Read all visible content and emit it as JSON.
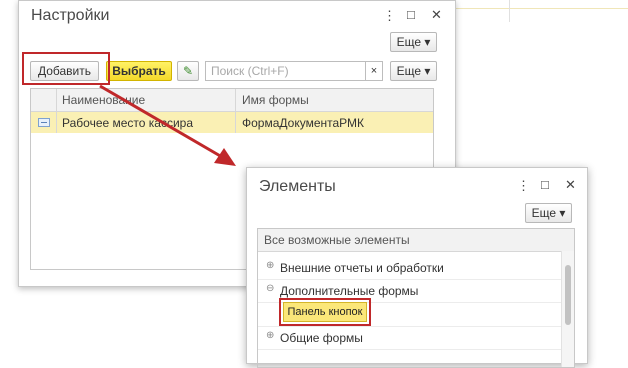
{
  "window1": {
    "title": "Настройки",
    "menu_icon": "⋮",
    "maximize_icon": "□",
    "close_icon": "✕",
    "more_label": "Еще ▾",
    "toolbar": {
      "add_label": "Добавить",
      "select_label": "Выбрать",
      "edit_icon": "✎",
      "search_placeholder": "Поиск (Ctrl+F)",
      "clear_icon": "×",
      "more_label": "Еще ▾"
    },
    "table": {
      "headers": [
        "Наименование",
        "Имя формы"
      ],
      "rows": [
        {
          "name": "Рабочее место кассира",
          "form": "ФормаДокументаРМК"
        }
      ]
    }
  },
  "window2": {
    "title": "Элементы",
    "menu_icon": "⋮",
    "maximize_icon": "□",
    "close_icon": "✕",
    "more_label": "Еще ▾",
    "tree": {
      "root": "Все возможные элементы",
      "items": [
        {
          "label": "Внешние отчеты и обработки",
          "expander": "⊕"
        },
        {
          "label": "Дополнительные формы",
          "expander": "⊖"
        },
        {
          "label": "Панель кнопок",
          "expander": ""
        },
        {
          "label": "Общие формы",
          "expander": "⊕"
        }
      ]
    }
  },
  "colors": {
    "highlight_red": "#c0282a",
    "select_yellow": "#fbe779",
    "row_yellow": "#faf0b4"
  }
}
